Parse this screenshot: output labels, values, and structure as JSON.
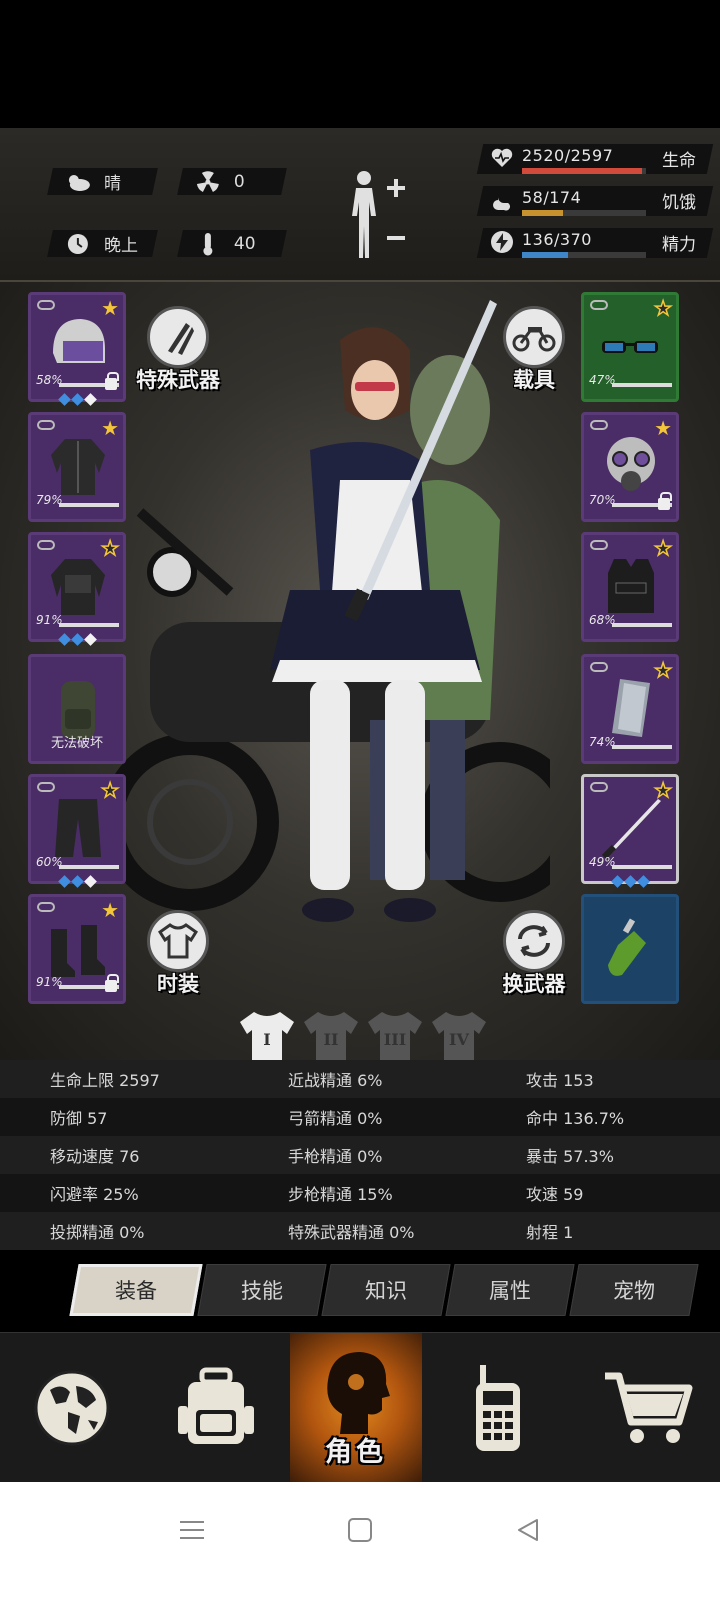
{
  "environment": {
    "weather": "晴",
    "radiation": "0",
    "time_of_day": "晚上",
    "temperature": "40"
  },
  "vitals": {
    "health": {
      "value": "2520/2597",
      "label": "生命",
      "fraction": 0.97,
      "color": "#d24a3c"
    },
    "hunger": {
      "value": "58/174",
      "label": "饥饿",
      "fraction": 0.33,
      "color": "#c8922e"
    },
    "energy": {
      "value": "136/370",
      "label": "精力",
      "fraction": 0.37,
      "color": "#3f86c8"
    }
  },
  "equipment": {
    "left": [
      {
        "name": "helmet",
        "pct": "58%",
        "star": "filled",
        "locked": true,
        "gems": [
          "blue",
          "blue",
          "white"
        ]
      },
      {
        "name": "jacket",
        "pct": "79%",
        "star": "filled",
        "locked": false,
        "gems": []
      },
      {
        "name": "armor-jacket",
        "pct": "91%",
        "star": "outline",
        "locked": false,
        "gems": [
          "blue",
          "blue",
          "white"
        ]
      },
      {
        "name": "backpack",
        "label": "无法破坏",
        "star": "none",
        "locked": false,
        "gems": []
      },
      {
        "name": "pants",
        "pct": "60%",
        "star": "outline",
        "locked": false,
        "gems": [
          "blue",
          "blue",
          "white"
        ]
      },
      {
        "name": "boots",
        "pct": "91%",
        "star": "filled",
        "locked": true,
        "gems": []
      }
    ],
    "right": [
      {
        "name": "glasses",
        "pct": "47%",
        "star": "outline",
        "locked": false,
        "gems": []
      },
      {
        "name": "gas-mask",
        "pct": "70%",
        "star": "filled",
        "locked": true,
        "gems": []
      },
      {
        "name": "vest",
        "pct": "68%",
        "star": "outline",
        "locked": false,
        "gems": []
      },
      {
        "name": "shield",
        "pct": "74%",
        "star": "outline",
        "locked": false,
        "gems": []
      },
      {
        "name": "katana",
        "pct": "49%",
        "star": "outline",
        "locked": false,
        "gems": [
          "blue",
          "blue",
          "blue"
        ]
      },
      {
        "name": "molotov",
        "star": "none",
        "locked": false,
        "gems": []
      }
    ]
  },
  "buttons": {
    "special_weapon": "特殊武器",
    "vehicle": "载具",
    "fashion": "时装",
    "swap_weapon": "换武器"
  },
  "outfit_tabs": [
    "I",
    "II",
    "III",
    "IV"
  ],
  "stats": [
    [
      "生命上限 2597",
      "近战精通 6%",
      "攻击 153"
    ],
    [
      "防御 57",
      "弓箭精通 0%",
      "命中 136.7%"
    ],
    [
      "移动速度 76",
      "手枪精通 0%",
      "暴击 57.3%"
    ],
    [
      "闪避率 25%",
      "步枪精通 15%",
      "攻速 59"
    ],
    [
      "投掷精通 0%",
      "特殊武器精通 0%",
      "射程 1"
    ]
  ],
  "tabs": [
    "装备",
    "技能",
    "知识",
    "属性",
    "宠物"
  ],
  "active_tab": "装备",
  "bottom_nav": {
    "role_label": "角色"
  }
}
